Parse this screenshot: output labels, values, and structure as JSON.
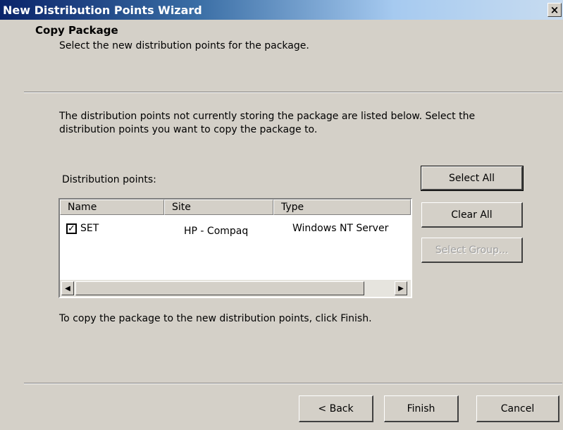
{
  "window": {
    "title": "New Distribution Points Wizard",
    "close_glyph": "×"
  },
  "header": {
    "title": "Copy Package",
    "subtitle": "Select the new distribution points for the package."
  },
  "main": {
    "description": "The distribution points not currently storing the package are listed below. Select the distribution points you  want to copy the package to.",
    "list_label": "Distribution points:",
    "columns": [
      "Name",
      "Site",
      "Type"
    ],
    "rows": [
      {
        "checked": true,
        "check_glyph": "✓",
        "name": "SET",
        "site": "HP - Compaq",
        "type": "Windows NT Server"
      }
    ],
    "finish_instruction": "To copy the package to the new distribution points, click Finish."
  },
  "side_buttons": {
    "select_all": "Select All",
    "clear_all": "Clear All",
    "select_group": "Select Group..."
  },
  "footer": {
    "back": "< Back",
    "finish": "Finish",
    "cancel": "Cancel"
  },
  "scrollbar": {
    "left_arrow": "◀",
    "right_arrow": "▶"
  }
}
